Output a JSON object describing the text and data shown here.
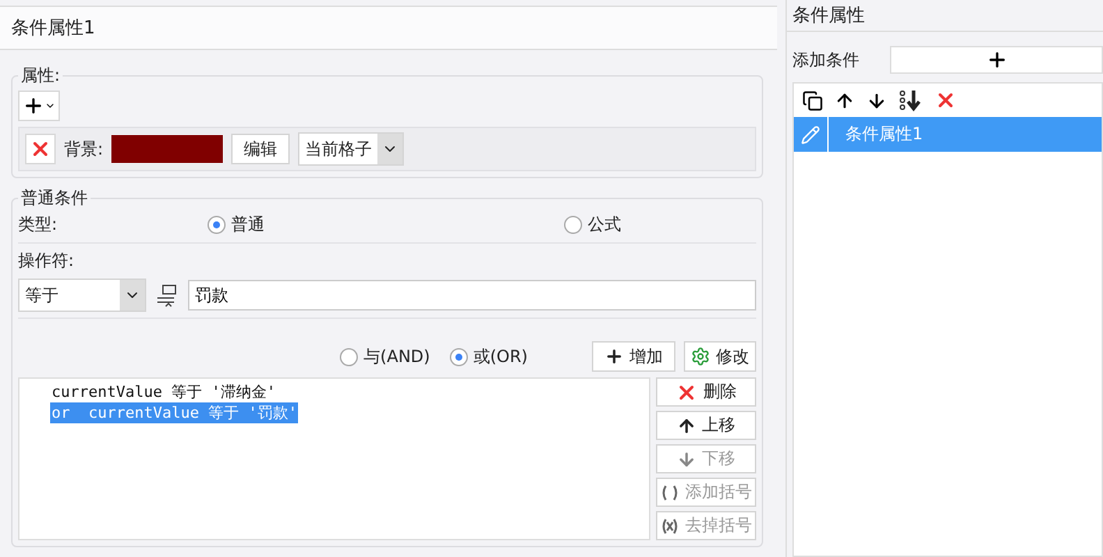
{
  "left_title": "条件属性1",
  "attributes": {
    "legend": "属性:",
    "background": {
      "label": "背景:",
      "color": "#800000",
      "edit_button": "编辑",
      "scope": "当前格子"
    }
  },
  "condition": {
    "legend": "普通条件",
    "type_label": "类型:",
    "types": [
      {
        "label": "普通",
        "selected": true
      },
      {
        "label": "公式",
        "selected": false
      }
    ],
    "operator_label": "操作符:",
    "operator": "等于",
    "value": "罚款",
    "logic": [
      {
        "label": "与(AND)",
        "selected": false
      },
      {
        "label": "或(OR)",
        "selected": true
      }
    ],
    "add_button": "增加",
    "modify_button": "修改",
    "list": [
      {
        "text": "currentValue 等于 '滞纳金'",
        "selected": false
      },
      {
        "text": "or  currentValue 等于 '罚款'",
        "selected": true
      }
    ],
    "actions": [
      {
        "kind": "delete",
        "label": "删除",
        "disabled": false
      },
      {
        "kind": "up",
        "label": "上移",
        "disabled": false
      },
      {
        "kind": "down",
        "label": "下移",
        "disabled": true
      },
      {
        "kind": "add_paren",
        "label": "添加括号",
        "disabled": true
      },
      {
        "kind": "remove_paren",
        "label": "去掉括号",
        "disabled": true
      }
    ]
  },
  "right": {
    "title": "条件属性",
    "add_label": "添加条件",
    "items": [
      {
        "label": "条件属性1",
        "selected": true
      }
    ]
  }
}
